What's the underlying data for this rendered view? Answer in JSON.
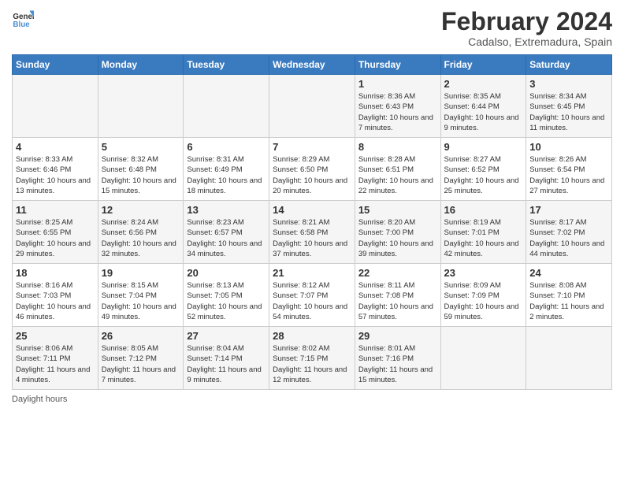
{
  "header": {
    "logo_line1": "General",
    "logo_line2": "Blue",
    "month_title": "February 2024",
    "subtitle": "Cadalso, Extremadura, Spain"
  },
  "days_of_week": [
    "Sunday",
    "Monday",
    "Tuesday",
    "Wednesday",
    "Thursday",
    "Friday",
    "Saturday"
  ],
  "weeks": [
    [
      {
        "day": "",
        "info": ""
      },
      {
        "day": "",
        "info": ""
      },
      {
        "day": "",
        "info": ""
      },
      {
        "day": "",
        "info": ""
      },
      {
        "day": "1",
        "info": "Sunrise: 8:36 AM\nSunset: 6:43 PM\nDaylight: 10 hours\nand 7 minutes."
      },
      {
        "day": "2",
        "info": "Sunrise: 8:35 AM\nSunset: 6:44 PM\nDaylight: 10 hours\nand 9 minutes."
      },
      {
        "day": "3",
        "info": "Sunrise: 8:34 AM\nSunset: 6:45 PM\nDaylight: 10 hours\nand 11 minutes."
      }
    ],
    [
      {
        "day": "4",
        "info": "Sunrise: 8:33 AM\nSunset: 6:46 PM\nDaylight: 10 hours\nand 13 minutes."
      },
      {
        "day": "5",
        "info": "Sunrise: 8:32 AM\nSunset: 6:48 PM\nDaylight: 10 hours\nand 15 minutes."
      },
      {
        "day": "6",
        "info": "Sunrise: 8:31 AM\nSunset: 6:49 PM\nDaylight: 10 hours\nand 18 minutes."
      },
      {
        "day": "7",
        "info": "Sunrise: 8:29 AM\nSunset: 6:50 PM\nDaylight: 10 hours\nand 20 minutes."
      },
      {
        "day": "8",
        "info": "Sunrise: 8:28 AM\nSunset: 6:51 PM\nDaylight: 10 hours\nand 22 minutes."
      },
      {
        "day": "9",
        "info": "Sunrise: 8:27 AM\nSunset: 6:52 PM\nDaylight: 10 hours\nand 25 minutes."
      },
      {
        "day": "10",
        "info": "Sunrise: 8:26 AM\nSunset: 6:54 PM\nDaylight: 10 hours\nand 27 minutes."
      }
    ],
    [
      {
        "day": "11",
        "info": "Sunrise: 8:25 AM\nSunset: 6:55 PM\nDaylight: 10 hours\nand 29 minutes."
      },
      {
        "day": "12",
        "info": "Sunrise: 8:24 AM\nSunset: 6:56 PM\nDaylight: 10 hours\nand 32 minutes."
      },
      {
        "day": "13",
        "info": "Sunrise: 8:23 AM\nSunset: 6:57 PM\nDaylight: 10 hours\nand 34 minutes."
      },
      {
        "day": "14",
        "info": "Sunrise: 8:21 AM\nSunset: 6:58 PM\nDaylight: 10 hours\nand 37 minutes."
      },
      {
        "day": "15",
        "info": "Sunrise: 8:20 AM\nSunset: 7:00 PM\nDaylight: 10 hours\nand 39 minutes."
      },
      {
        "day": "16",
        "info": "Sunrise: 8:19 AM\nSunset: 7:01 PM\nDaylight: 10 hours\nand 42 minutes."
      },
      {
        "day": "17",
        "info": "Sunrise: 8:17 AM\nSunset: 7:02 PM\nDaylight: 10 hours\nand 44 minutes."
      }
    ],
    [
      {
        "day": "18",
        "info": "Sunrise: 8:16 AM\nSunset: 7:03 PM\nDaylight: 10 hours\nand 46 minutes."
      },
      {
        "day": "19",
        "info": "Sunrise: 8:15 AM\nSunset: 7:04 PM\nDaylight: 10 hours\nand 49 minutes."
      },
      {
        "day": "20",
        "info": "Sunrise: 8:13 AM\nSunset: 7:05 PM\nDaylight: 10 hours\nand 52 minutes."
      },
      {
        "day": "21",
        "info": "Sunrise: 8:12 AM\nSunset: 7:07 PM\nDaylight: 10 hours\nand 54 minutes."
      },
      {
        "day": "22",
        "info": "Sunrise: 8:11 AM\nSunset: 7:08 PM\nDaylight: 10 hours\nand 57 minutes."
      },
      {
        "day": "23",
        "info": "Sunrise: 8:09 AM\nSunset: 7:09 PM\nDaylight: 10 hours\nand 59 minutes."
      },
      {
        "day": "24",
        "info": "Sunrise: 8:08 AM\nSunset: 7:10 PM\nDaylight: 11 hours\nand 2 minutes."
      }
    ],
    [
      {
        "day": "25",
        "info": "Sunrise: 8:06 AM\nSunset: 7:11 PM\nDaylight: 11 hours\nand 4 minutes."
      },
      {
        "day": "26",
        "info": "Sunrise: 8:05 AM\nSunset: 7:12 PM\nDaylight: 11 hours\nand 7 minutes."
      },
      {
        "day": "27",
        "info": "Sunrise: 8:04 AM\nSunset: 7:14 PM\nDaylight: 11 hours\nand 9 minutes."
      },
      {
        "day": "28",
        "info": "Sunrise: 8:02 AM\nSunset: 7:15 PM\nDaylight: 11 hours\nand 12 minutes."
      },
      {
        "day": "29",
        "info": "Sunrise: 8:01 AM\nSunset: 7:16 PM\nDaylight: 11 hours\nand 15 minutes."
      },
      {
        "day": "",
        "info": ""
      },
      {
        "day": "",
        "info": ""
      }
    ]
  ],
  "footer": {
    "daylight_label": "Daylight hours"
  }
}
